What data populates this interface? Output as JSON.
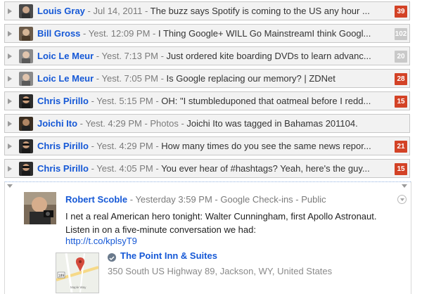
{
  "feed": {
    "rows": [
      {
        "author": "Louis Gray",
        "meta": " - Jul 14, 2011 - ",
        "snippet": "The buzz says Spotify is coming to the US any hour ...",
        "count": "39",
        "count_style": "red",
        "avatar_color": "#4a4a4a"
      },
      {
        "author": "Bill Gross",
        "meta": " - Yest. 12:09 PM - ",
        "snippet": "I Thing Google+ WILL Go MainstreamI think Googl...",
        "count": "102",
        "count_style": "gray",
        "avatar_color": "#6b5b4a"
      },
      {
        "author": "Loic Le Meur",
        "meta": " - Yest. 7:13 PM - ",
        "snippet": "Just ordered kite boarding DVDs to learn advanc...",
        "count": "20",
        "count_style": "gray",
        "avatar_color": "#8a8a8a"
      },
      {
        "author": "Loic Le Meur",
        "meta": " - Yest. 7:05 PM - ",
        "snippet": "Is Google replacing our memory? | ZDNet",
        "count": "28",
        "count_style": "red",
        "avatar_color": "#8a8a8a"
      },
      {
        "author": "Chris Pirillo",
        "meta": " - Yest. 5:15 PM - ",
        "snippet": "OH: \"I stumbleduponed that oatmeal before I redd...",
        "count": "15",
        "count_style": "red",
        "avatar_color": "#2c2c2c"
      },
      {
        "author": "Joichi Ito",
        "meta": " - Yest. 4:29 PM - Photos - ",
        "snippet": "Joichi Ito was tagged in Bahamas 201104.",
        "count": "",
        "count_style": "none",
        "avatar_color": "#3a2e22"
      },
      {
        "author": "Chris Pirillo",
        "meta": " - Yest. 4:29 PM - ",
        "snippet": "How many times do you see the same news repor...",
        "count": "21",
        "count_style": "red",
        "avatar_color": "#2c2c2c"
      },
      {
        "author": "Chris Pirillo",
        "meta": " - Yest. 4:05 PM - ",
        "snippet": "You ever hear of #hashtags? Yeah, here's the guy...",
        "count": "15",
        "count_style": "red",
        "avatar_color": "#2c2c2c"
      }
    ]
  },
  "expanded_post": {
    "author": "Robert Scoble",
    "meta": " - Yesterday 3:59 PM - Google Check-ins - Public",
    "body": "I net a real American hero tonight: Walter Cunningham, first Apollo Astronaut. Listen in on a five-minute conversation we had:",
    "link": "http://t.co/kplsyT9",
    "place_name": "The Point Inn & Suites",
    "place_address": "350 South US Highway 89, Jackson, WY, United States",
    "map_label": "Maple Way",
    "map_shield": "189"
  },
  "colors": {
    "accent": "#1558d6",
    "badge_red": "#d34226",
    "badge_gray": "#c9c9c9"
  },
  "icons": {
    "row_expand": "triangle-right-icon",
    "collapse": "triangle-down-icon",
    "menu": "chevron-down-circle-icon",
    "place": "checkin-icon",
    "map": "map-thumbnail"
  }
}
